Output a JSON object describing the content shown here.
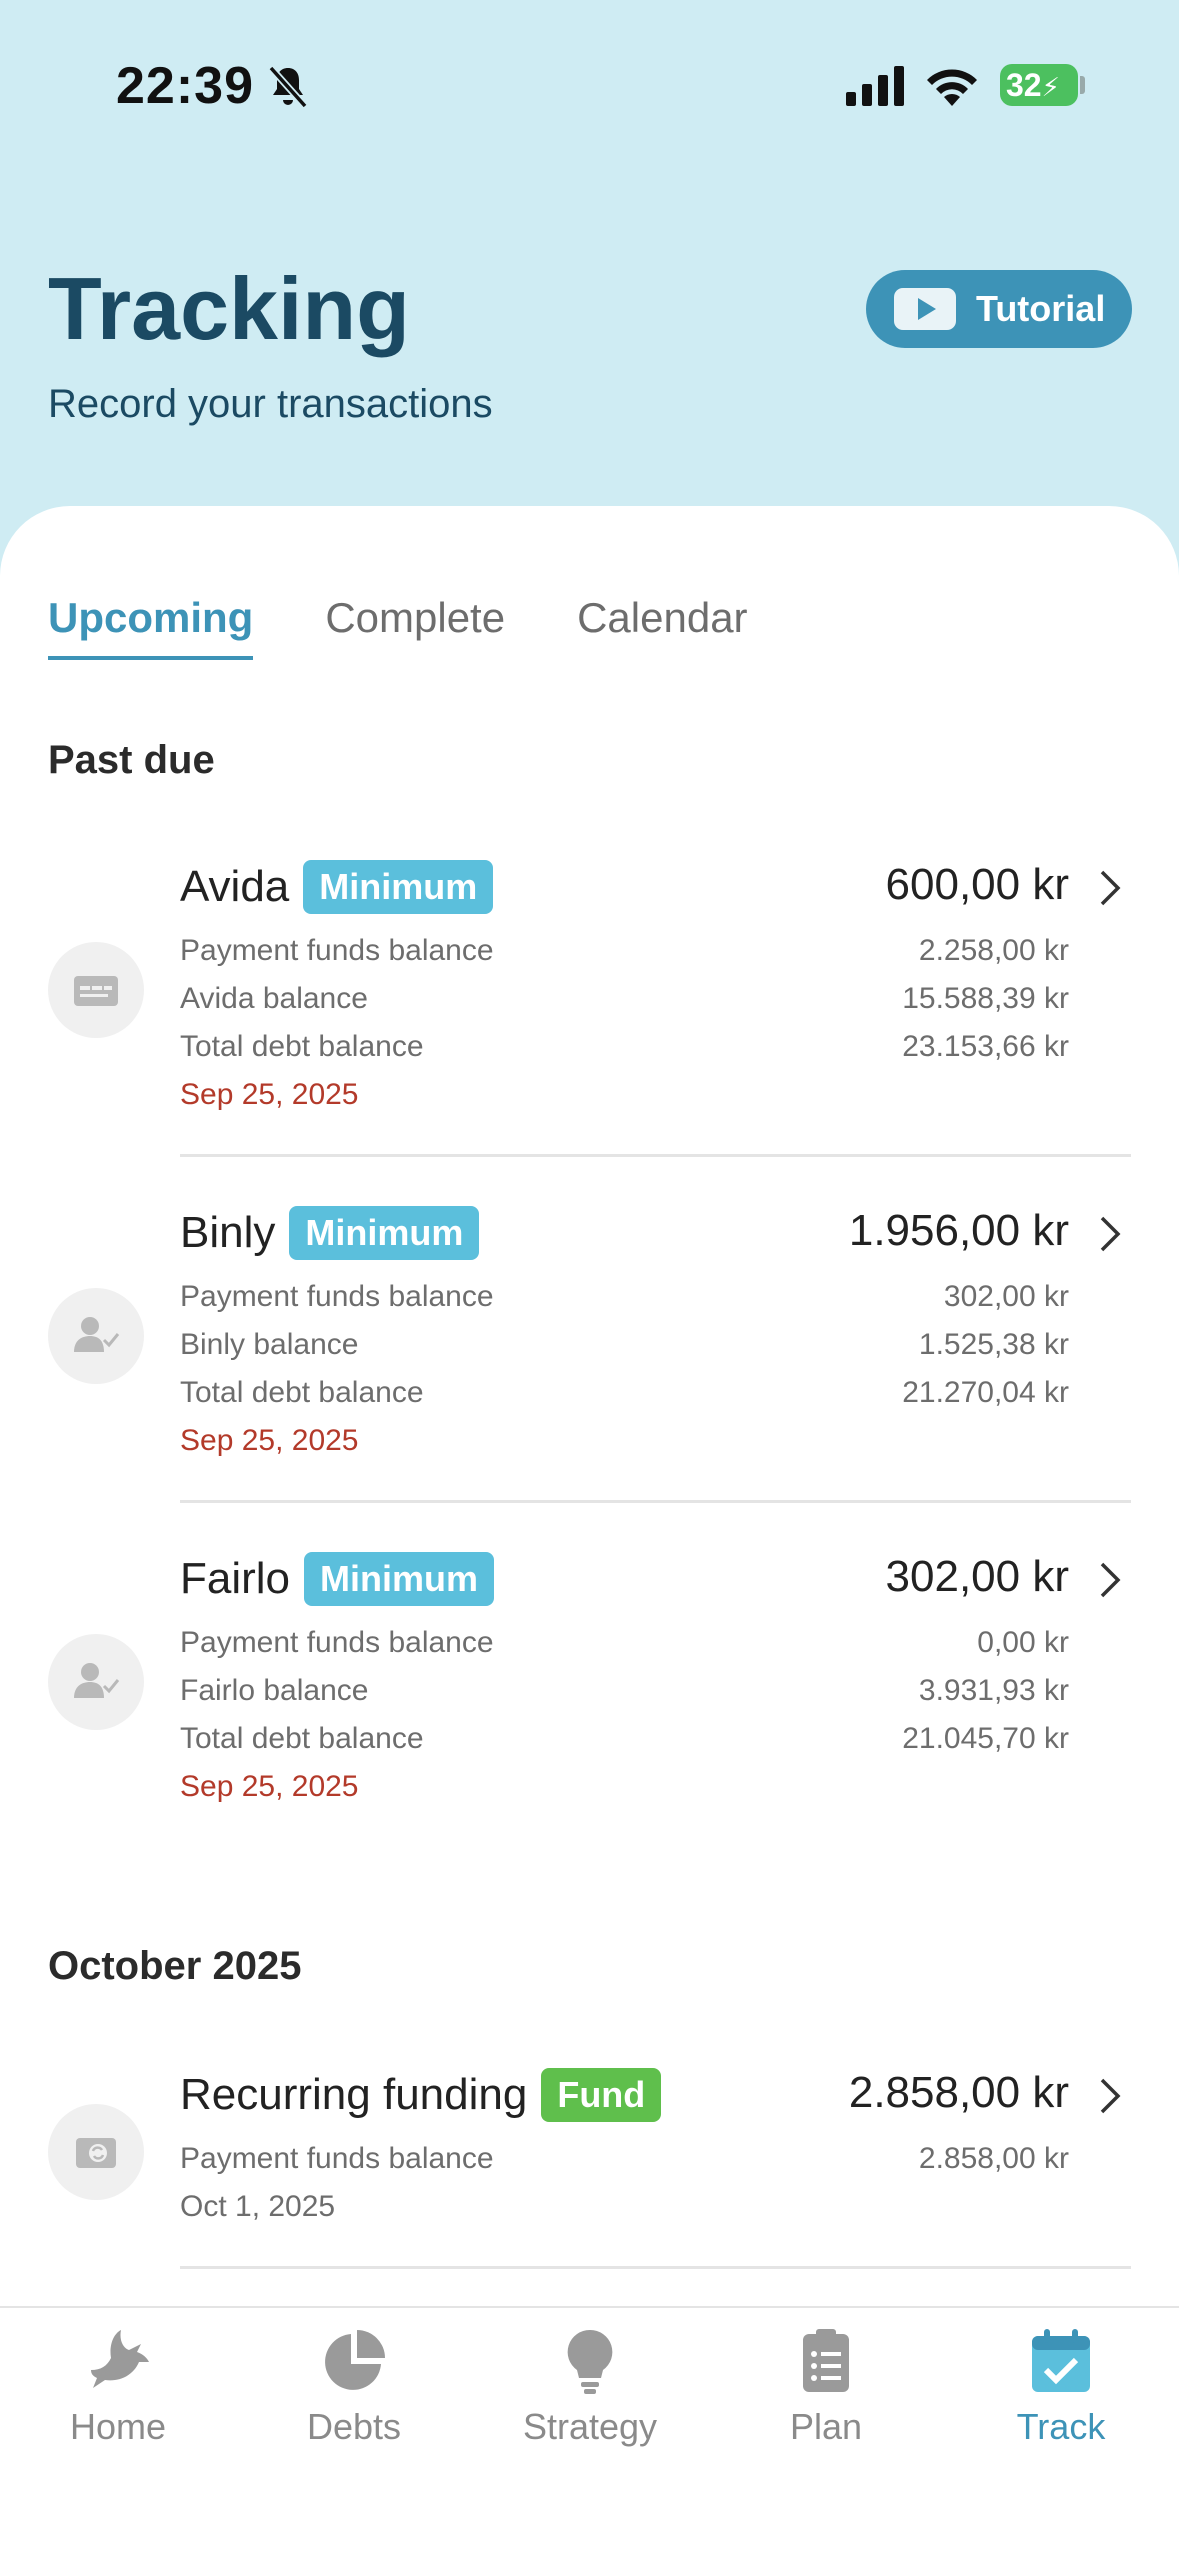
{
  "status_bar": {
    "time": "22:39",
    "battery": "32"
  },
  "header": {
    "title": "Tracking",
    "subtitle": "Record your transactions",
    "tutorial_label": "Tutorial"
  },
  "tabs": [
    {
      "label": "Upcoming",
      "active": true
    },
    {
      "label": "Complete",
      "active": false
    },
    {
      "label": "Calendar",
      "active": false
    }
  ],
  "sections": [
    {
      "title": "Past due",
      "items": [
        {
          "name": "Avida",
          "badge": "Minimum",
          "amount": "600,00 kr",
          "rows": [
            {
              "label": "Payment funds balance",
              "value": "2.258,00 kr"
            },
            {
              "label": "Avida balance",
              "value": "15.588,39 kr"
            },
            {
              "label": "Total debt balance",
              "value": "23.153,66 kr"
            }
          ],
          "date": "Sep 25, 2025",
          "icon": "credit-card-icon"
        },
        {
          "name": "Binly",
          "badge": "Minimum",
          "amount": "1.956,00 kr",
          "rows": [
            {
              "label": "Payment funds balance",
              "value": "302,00 kr"
            },
            {
              "label": "Binly balance",
              "value": "1.525,38 kr"
            },
            {
              "label": "Total debt balance",
              "value": "21.270,04 kr"
            }
          ],
          "date": "Sep 25, 2025",
          "icon": "user-check-icon"
        },
        {
          "name": "Fairlo",
          "badge": "Minimum",
          "amount": "302,00 kr",
          "rows": [
            {
              "label": "Payment funds balance",
              "value": "0,00 kr"
            },
            {
              "label": "Fairlo balance",
              "value": "3.931,93 kr"
            },
            {
              "label": "Total debt balance",
              "value": "21.045,70 kr"
            }
          ],
          "date": "Sep 25, 2025",
          "icon": "user-check-icon"
        }
      ]
    },
    {
      "title": "October 2025",
      "items": [
        {
          "name": "Recurring funding",
          "badge": "Fund",
          "amount": "2.858,00 kr",
          "rows": [
            {
              "label": "Payment funds balance",
              "value": "2.858,00 kr"
            }
          ],
          "date": "Oct 1, 2025",
          "icon": "wallet-recurring-icon"
        }
      ]
    }
  ],
  "nav": [
    {
      "label": "Home",
      "icon": "dove-icon",
      "active": false
    },
    {
      "label": "Debts",
      "icon": "pie-chart-icon",
      "active": false
    },
    {
      "label": "Strategy",
      "icon": "lightbulb-icon",
      "active": false
    },
    {
      "label": "Plan",
      "icon": "clipboard-list-icon",
      "active": false
    },
    {
      "label": "Track",
      "icon": "calendar-check-icon",
      "active": true
    }
  ],
  "colors": {
    "accent": "#3d93b7",
    "header_bg": "#cfecf3",
    "minimum_badge": "#5bbfdc",
    "fund_badge": "#5fbf4c",
    "past_due_date": "#b33a2a"
  }
}
